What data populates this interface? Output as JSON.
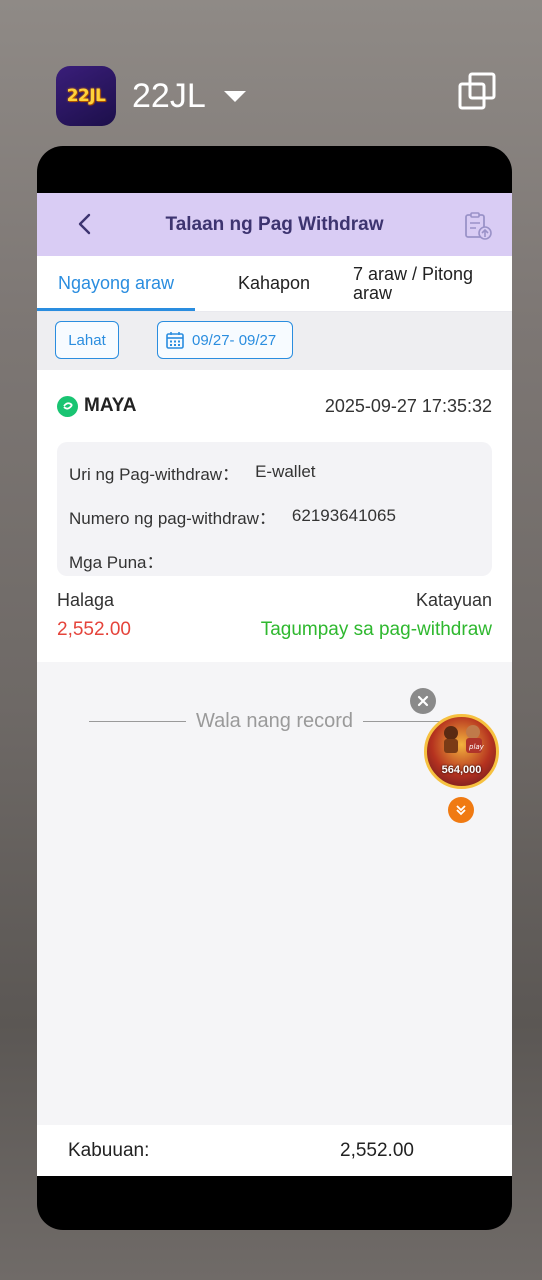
{
  "app": {
    "name": "22JL",
    "logo_text": "22JL"
  },
  "header": {
    "title": "Talaan ng Pag Withdraw"
  },
  "tabs": [
    {
      "label": "Ngayong araw",
      "active": true
    },
    {
      "label": "Kahapon",
      "active": false
    },
    {
      "label": "7 araw / Pitong araw",
      "active": false
    }
  ],
  "filters": {
    "all_label": "Lahat",
    "date_range": "09/27- 09/27"
  },
  "record": {
    "method": "MAYA",
    "datetime": "2025-09-27 17:35:32",
    "type_label": "Uri ng Pag-withdraw：",
    "type_value": "E-wallet",
    "number_label": "Numero ng pag-withdraw：",
    "number_value": "62193641065",
    "remarks_label": "Mga Puna：",
    "amount_label": "Halaga",
    "amount_value": "2,552.00",
    "status_label": "Katayuan",
    "status_value": "Tagumpay sa pag-withdraw"
  },
  "empty_text": "Wala nang record",
  "floating_ad": {
    "amount_text": "564,000"
  },
  "footer": {
    "total_label": "Kabuuan:",
    "total_value": "2,552.00"
  },
  "colors": {
    "accent": "#2a8ddf",
    "amount": "#e5443b",
    "success": "#2fb82f",
    "header_bg": "#d9ccf4"
  }
}
